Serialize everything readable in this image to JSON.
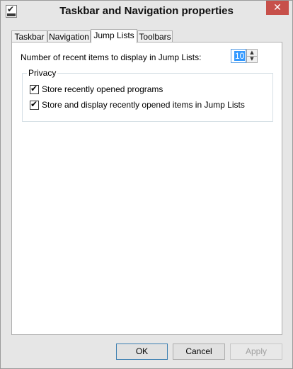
{
  "window": {
    "title": "Taskbar and Navigation properties",
    "close_glyph": "✕"
  },
  "tabs": [
    {
      "label": "Taskbar",
      "selected": false
    },
    {
      "label": "Navigation",
      "selected": false
    },
    {
      "label": "Jump Lists",
      "selected": true
    },
    {
      "label": "Toolbars",
      "selected": false
    }
  ],
  "jump_lists": {
    "recent_label": "Number of recent items to display in Jump Lists:",
    "recent_value": "10",
    "privacy_label": "Privacy",
    "checkboxes": [
      {
        "label": "Store recently opened programs",
        "checked": true
      },
      {
        "label": "Store and display recently opened items in Jump Lists",
        "checked": true
      }
    ]
  },
  "buttons": {
    "ok": "OK",
    "cancel": "Cancel",
    "apply": "Apply"
  },
  "icons": {
    "app": "properties-icon",
    "check": "✔",
    "spin_up": "▲",
    "spin_down": "▼"
  },
  "colors": {
    "close_button": "#c7504a",
    "selection": "#3399ff",
    "default_button_border": "#3c7fb1"
  }
}
